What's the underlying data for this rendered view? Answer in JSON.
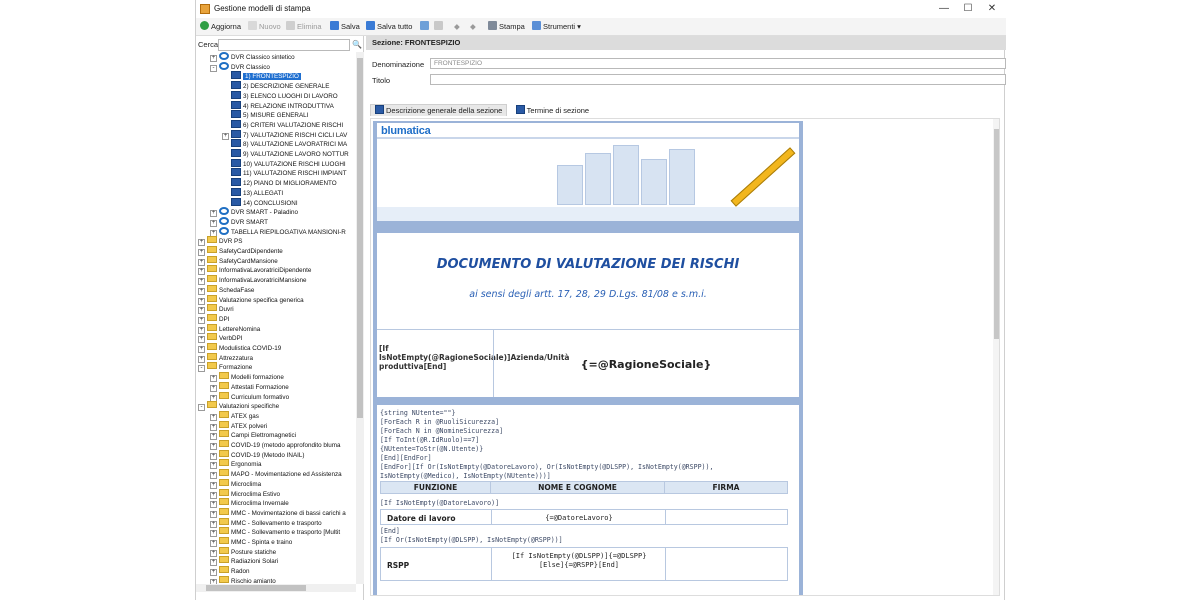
{
  "window": {
    "title": "Gestione modelli di stampa",
    "min": "—",
    "max": "☐",
    "close": "✕"
  },
  "toolbar": {
    "aggiorna": "Aggiorna",
    "nuovo": "Nuovo",
    "elimina": "Elimina",
    "salva": "Salva",
    "salva_tutto": "Salva tutto",
    "stampa": "Stampa",
    "strumenti": "Strumenti ▾"
  },
  "search": {
    "label": "Cerca",
    "value": ""
  },
  "tree": [
    {
      "text": "DVR Classico sintetico",
      "icon": "dvr",
      "lv": 2,
      "exp": "+"
    },
    {
      "text": "DVR Classico",
      "icon": "dvr",
      "lv": 2,
      "exp": "-"
    },
    {
      "text": "1) FRONTESPIZIO",
      "icon": "doc",
      "lv": 3,
      "sel": true
    },
    {
      "text": "2) DESCRIZIONE GENERALE",
      "icon": "doc",
      "lv": 3
    },
    {
      "text": "3) ELENCO LUOGHI DI LAVORO",
      "icon": "doc",
      "lv": 3
    },
    {
      "text": "4) RELAZIONE INTRODUTTIVA",
      "icon": "doc",
      "lv": 3
    },
    {
      "text": "5) MISURE GENERALI",
      "icon": "doc",
      "lv": 3
    },
    {
      "text": "6) CRITERI VALUTAZIONE RISCHI",
      "icon": "doc",
      "lv": 3
    },
    {
      "text": "7) VALUTAZIONE RISCHI CICLI LAV",
      "icon": "doc",
      "lv": 3,
      "exp": "+"
    },
    {
      "text": "8) VALUTAZIONE LAVORATRICI MA",
      "icon": "doc",
      "lv": 3
    },
    {
      "text": "9) VALUTAZIONE LAVORO NOTTUR",
      "icon": "doc",
      "lv": 3
    },
    {
      "text": "10) VALUTAZIONE RISCHI LUOGHI",
      "icon": "doc",
      "lv": 3
    },
    {
      "text": "11) VALUTAZIONE RISCHI IMPIANT",
      "icon": "doc",
      "lv": 3
    },
    {
      "text": "12) PIANO DI MIGLIORAMENTO",
      "icon": "doc",
      "lv": 3
    },
    {
      "text": "13) ALLEGATI",
      "icon": "doc",
      "lv": 3
    },
    {
      "text": "14) CONCLUSIONI",
      "icon": "doc",
      "lv": 3
    },
    {
      "text": "DVR SMART - Paladino",
      "icon": "dvr",
      "lv": 2,
      "exp": "+"
    },
    {
      "text": "DVR SMART",
      "icon": "dvr",
      "lv": 2,
      "exp": "+"
    },
    {
      "text": "TABELLA RIEPILOGATIVA MANSIONI-R",
      "icon": "dvr",
      "lv": 2,
      "exp": "+"
    },
    {
      "text": "DVR PS",
      "icon": "folder",
      "lv": 1,
      "exp": "+"
    },
    {
      "text": "SafetyCardDipendente",
      "icon": "folder",
      "lv": 1,
      "exp": "+"
    },
    {
      "text": "SafetyCardMansione",
      "icon": "folder",
      "lv": 1,
      "exp": "+"
    },
    {
      "text": "InformativaLavoratriciDipendente",
      "icon": "folder",
      "lv": 1,
      "exp": "+"
    },
    {
      "text": "InformativaLavoratriciMansione",
      "icon": "folder",
      "lv": 1,
      "exp": "+"
    },
    {
      "text": "SchedaFase",
      "icon": "folder",
      "lv": 1,
      "exp": "+"
    },
    {
      "text": "Valutazione specifica generica",
      "icon": "folder",
      "lv": 1,
      "exp": "+"
    },
    {
      "text": "Duvri",
      "icon": "folder",
      "lv": 1,
      "exp": "+"
    },
    {
      "text": "DPI",
      "icon": "folder",
      "lv": 1,
      "exp": "+"
    },
    {
      "text": "LettereNomina",
      "icon": "folder",
      "lv": 1,
      "exp": "+"
    },
    {
      "text": "VerbDPI",
      "icon": "folder",
      "lv": 1,
      "exp": "+"
    },
    {
      "text": "Modulistica COVID-19",
      "icon": "folder",
      "lv": 1,
      "exp": "+"
    },
    {
      "text": "Attrezzatura",
      "icon": "folder",
      "lv": 1,
      "exp": "+"
    },
    {
      "text": "Formazione",
      "icon": "folder",
      "lv": 1,
      "exp": "-"
    },
    {
      "text": "Modelli formazione",
      "icon": "folder",
      "lv": 2,
      "exp": "+"
    },
    {
      "text": "Attestati Formazione",
      "icon": "folder",
      "lv": 2,
      "exp": "+"
    },
    {
      "text": "Curriculum formativo",
      "icon": "folder",
      "lv": 2,
      "exp": "+"
    },
    {
      "text": "Valutazioni specifiche",
      "icon": "folder",
      "lv": 1,
      "exp": "-"
    },
    {
      "text": "ATEX gas",
      "icon": "folder",
      "lv": 2,
      "exp": "+"
    },
    {
      "text": "ATEX polveri",
      "icon": "folder",
      "lv": 2,
      "exp": "+"
    },
    {
      "text": "Campi Elettromagnetici",
      "icon": "folder",
      "lv": 2,
      "exp": "+"
    },
    {
      "text": "COVID-19 (metodo approfondito bluma",
      "icon": "folder",
      "lv": 2,
      "exp": "+"
    },
    {
      "text": "COVID-19 (Metodo INAIL)",
      "icon": "folder",
      "lv": 2,
      "exp": "+"
    },
    {
      "text": "Ergonomia",
      "icon": "folder",
      "lv": 2,
      "exp": "+"
    },
    {
      "text": "MAPO - Movimentazione ed Assistenza",
      "icon": "folder",
      "lv": 2,
      "exp": "+"
    },
    {
      "text": "Microclima",
      "icon": "folder",
      "lv": 2,
      "exp": "+"
    },
    {
      "text": "Microclima Estivo",
      "icon": "folder",
      "lv": 2,
      "exp": "+"
    },
    {
      "text": "Microclima Invernale",
      "icon": "folder",
      "lv": 2,
      "exp": "+"
    },
    {
      "text": "MMC - Movimentazione di bassi carichi a",
      "icon": "folder",
      "lv": 2,
      "exp": "+"
    },
    {
      "text": "MMC - Sollevamento e trasporto",
      "icon": "folder",
      "lv": 2,
      "exp": "+"
    },
    {
      "text": "MMC - Sollevamento e trasporto [Multit",
      "icon": "folder",
      "lv": 2,
      "exp": "+"
    },
    {
      "text": "MMC - Spinta e traino",
      "icon": "folder",
      "lv": 2,
      "exp": "+"
    },
    {
      "text": "Posture statiche",
      "icon": "folder",
      "lv": 2,
      "exp": "+"
    },
    {
      "text": "Radiazioni Solari",
      "icon": "folder",
      "lv": 2,
      "exp": "+"
    },
    {
      "text": "Radon",
      "icon": "folder",
      "lv": 2,
      "exp": "+"
    },
    {
      "text": "Rischio amianto",
      "icon": "folder",
      "lv": 2,
      "exp": "+"
    }
  ],
  "section": {
    "header": "Sezione: FRONTESPIZIO",
    "denominazione_label": "Denominazione",
    "denominazione_value": "FRONTESPIZIO",
    "titolo_label": "Titolo",
    "titolo_value": ""
  },
  "tabs": [
    {
      "label": "Descrizione generale della sezione",
      "active": true
    },
    {
      "label": "Termine di sezione",
      "active": false
    }
  ],
  "document": {
    "logo": "blumatica",
    "title": "DOCUMENTO DI VALUTAZIONE DEI RISCHI",
    "subtitle": "ai sensi degli artt. 17, 28, 29 D.Lgs. 81/08 e s.m.i.",
    "rag_label": "[If IsNotEmpty(@RagioneSociale)]Azienda/Unità produttiva[End]",
    "rag_value": "{=@RagioneSociale}",
    "code_lines": [
      "{string NUtente=\"\"}",
      "[ForEach R in @RuoliSicurezza]",
      "[ForEach N in @NomineSicurezza]",
      "[If ToInt(@R.IdRuolo)==7]",
      "{NUtente=ToStr(@N.Utente)}",
      "[End][EndFor]",
      "[EndFor][If Or(IsNotEmpty(@DatoreLavoro), Or(IsNotEmpty(@DLSPP), IsNotEmpty(@RSPP)),",
      "IsNotEmpty(@Medico), IsNotEmpty(NUtente)))]"
    ],
    "table_headers": [
      "FUNZIONE",
      "NOME E COGNOME",
      "FIRMA"
    ],
    "row1_pre": "[If IsNotEmpty(@DatoreLavoro)]",
    "row1_func": "Datore di lavoro",
    "row1_name": "{=@DatoreLavoro}",
    "row1_post": "[End]",
    "row2_pre": "[If Or(IsNotEmpty(@DLSPP), IsNotEmpty(@RSPP))]",
    "row2_func": "RSPP",
    "row2_name": "[If IsNotEmpty(@DLSPP)]{=@DLSPP}[Else]{=@RSPP}[End]"
  }
}
